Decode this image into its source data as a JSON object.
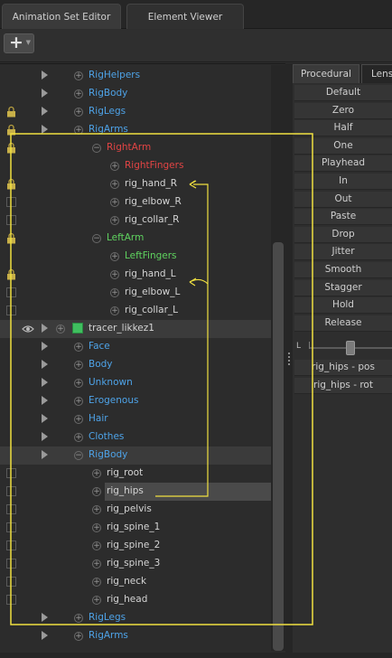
{
  "tabs": [
    {
      "label": "Animation Set Editor",
      "active": true
    },
    {
      "label": "Element Viewer",
      "active": false
    }
  ],
  "toolbar": {
    "add_label": "+",
    "add_icon": "plus-icon",
    "dropdown_icon": "chevron-down-icon"
  },
  "tree_rows": [
    {
      "label": "RigHelpers",
      "color": "blue",
      "indent": 1,
      "lock": false,
      "box": false,
      "arrow": true,
      "exp": true
    },
    {
      "label": "RigBody",
      "color": "blue",
      "indent": 1,
      "lock": false,
      "box": false,
      "arrow": true,
      "exp": true
    },
    {
      "label": "RigLegs",
      "color": "blue",
      "indent": 1,
      "lock": true,
      "box": false,
      "arrow": true,
      "exp": true
    },
    {
      "label": "RigArms",
      "color": "blue",
      "indent": 1,
      "lock": true,
      "box": false,
      "arrow": true,
      "exp": true
    },
    {
      "label": "RightArm",
      "color": "red",
      "indent": 2,
      "lock": true,
      "box": false,
      "arrow": false,
      "exp": true
    },
    {
      "label": "RightFingers",
      "color": "red",
      "indent": 3,
      "lock": false,
      "box": false,
      "arrow": false,
      "exp": true
    },
    {
      "label": "rig_hand_R",
      "color": "white",
      "indent": 3,
      "lock": true,
      "box": false,
      "arrow": false,
      "exp": true
    },
    {
      "label": "rig_elbow_R",
      "color": "white",
      "indent": 3,
      "lock": false,
      "box": true,
      "arrow": false,
      "exp": true
    },
    {
      "label": "rig_collar_R",
      "color": "white",
      "indent": 3,
      "lock": false,
      "box": true,
      "arrow": false,
      "exp": true
    },
    {
      "label": "LeftArm",
      "color": "green",
      "indent": 2,
      "lock": true,
      "box": false,
      "arrow": false,
      "exp": true
    },
    {
      "label": "LeftFingers",
      "color": "green",
      "indent": 3,
      "lock": false,
      "box": false,
      "arrow": false,
      "exp": true
    },
    {
      "label": "rig_hand_L",
      "color": "white",
      "indent": 3,
      "lock": true,
      "box": false,
      "arrow": false,
      "exp": true
    },
    {
      "label": "rig_elbow_L",
      "color": "white",
      "indent": 3,
      "lock": false,
      "box": true,
      "arrow": false,
      "exp": true
    },
    {
      "label": "rig_collar_L",
      "color": "white",
      "indent": 3,
      "lock": false,
      "box": true,
      "arrow": false,
      "exp": true
    },
    {
      "label": "tracer_likkez1",
      "color": "white",
      "indent": 0,
      "lock": false,
      "box": false,
      "arrow": true,
      "exp": true,
      "eye": true,
      "cube": true,
      "selected": true
    },
    {
      "label": "Face",
      "color": "blue",
      "indent": 1,
      "lock": false,
      "box": false,
      "arrow": true,
      "exp": true
    },
    {
      "label": "Body",
      "color": "blue",
      "indent": 1,
      "lock": false,
      "box": false,
      "arrow": true,
      "exp": true
    },
    {
      "label": "Unknown",
      "color": "blue",
      "indent": 1,
      "lock": false,
      "box": false,
      "arrow": true,
      "exp": true
    },
    {
      "label": "Erogenous",
      "color": "blue",
      "indent": 1,
      "lock": false,
      "box": false,
      "arrow": true,
      "exp": true
    },
    {
      "label": "Hair",
      "color": "blue",
      "indent": 1,
      "lock": false,
      "box": false,
      "arrow": true,
      "exp": true
    },
    {
      "label": "Clothes",
      "color": "blue",
      "indent": 1,
      "lock": false,
      "box": false,
      "arrow": true,
      "exp": true
    },
    {
      "label": "RigBody",
      "color": "blue",
      "indent": 1,
      "lock": false,
      "box": false,
      "arrow": true,
      "exp": true,
      "selected": true
    },
    {
      "label": "rig_root",
      "color": "white",
      "indent": 2,
      "lock": false,
      "box": true,
      "arrow": false,
      "exp": true
    },
    {
      "label": "rig_hips",
      "color": "white",
      "indent": 2,
      "lock": false,
      "box": true,
      "arrow": false,
      "exp": true,
      "highlight": true
    },
    {
      "label": "rig_pelvis",
      "color": "white",
      "indent": 2,
      "lock": false,
      "box": true,
      "arrow": false,
      "exp": true
    },
    {
      "label": "rig_spine_1",
      "color": "white",
      "indent": 2,
      "lock": false,
      "box": true,
      "arrow": false,
      "exp": true
    },
    {
      "label": "rig_spine_2",
      "color": "white",
      "indent": 2,
      "lock": false,
      "box": true,
      "arrow": false,
      "exp": true
    },
    {
      "label": "rig_spine_3",
      "color": "white",
      "indent": 2,
      "lock": false,
      "box": true,
      "arrow": false,
      "exp": true
    },
    {
      "label": "rig_neck",
      "color": "white",
      "indent": 2,
      "lock": false,
      "box": true,
      "arrow": false,
      "exp": true
    },
    {
      "label": "rig_head",
      "color": "white",
      "indent": 2,
      "lock": false,
      "box": true,
      "arrow": false,
      "exp": true
    },
    {
      "label": "RigLegs",
      "color": "blue",
      "indent": 1,
      "lock": false,
      "box": false,
      "arrow": true,
      "exp": true
    },
    {
      "label": "RigArms",
      "color": "blue",
      "indent": 1,
      "lock": false,
      "box": false,
      "arrow": true,
      "exp": true
    }
  ],
  "right_panel": {
    "tabs": [
      {
        "label": "Procedural",
        "active": true
      },
      {
        "label": "Lense",
        "active": false
      }
    ],
    "buttons": [
      "Default",
      "Zero",
      "Half",
      "One",
      "Playhead",
      "In",
      "Out",
      "Paste",
      "Drop",
      "Jitter",
      "Smooth",
      "Stagger",
      "Hold",
      "Release"
    ],
    "slider_label": "L",
    "slider_value": 0.5,
    "items": [
      "rig_hips - pos",
      "rig_hips - rot"
    ]
  },
  "colors": {
    "blue": "#4ea3e8",
    "red": "#e24444",
    "green": "#5fd35f",
    "annotation": "#f0e040"
  }
}
